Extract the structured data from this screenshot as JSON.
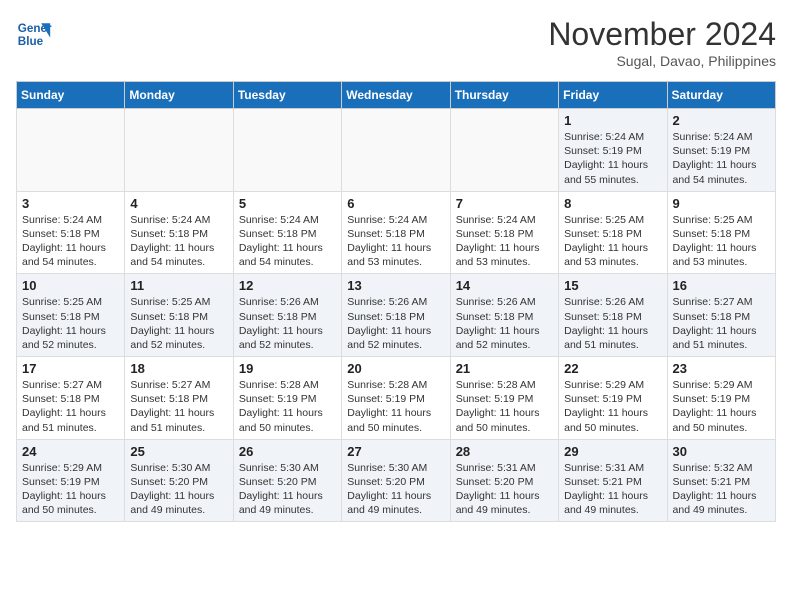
{
  "header": {
    "logo_line1": "General",
    "logo_line2": "Blue",
    "month_title": "November 2024",
    "location": "Sugal, Davao, Philippines"
  },
  "weekdays": [
    "Sunday",
    "Monday",
    "Tuesday",
    "Wednesday",
    "Thursday",
    "Friday",
    "Saturday"
  ],
  "weeks": [
    [
      {
        "day": "",
        "info": ""
      },
      {
        "day": "",
        "info": ""
      },
      {
        "day": "",
        "info": ""
      },
      {
        "day": "",
        "info": ""
      },
      {
        "day": "",
        "info": ""
      },
      {
        "day": "1",
        "info": "Sunrise: 5:24 AM\nSunset: 5:19 PM\nDaylight: 11 hours\nand 55 minutes."
      },
      {
        "day": "2",
        "info": "Sunrise: 5:24 AM\nSunset: 5:19 PM\nDaylight: 11 hours\nand 54 minutes."
      }
    ],
    [
      {
        "day": "3",
        "info": "Sunrise: 5:24 AM\nSunset: 5:18 PM\nDaylight: 11 hours\nand 54 minutes."
      },
      {
        "day": "4",
        "info": "Sunrise: 5:24 AM\nSunset: 5:18 PM\nDaylight: 11 hours\nand 54 minutes."
      },
      {
        "day": "5",
        "info": "Sunrise: 5:24 AM\nSunset: 5:18 PM\nDaylight: 11 hours\nand 54 minutes."
      },
      {
        "day": "6",
        "info": "Sunrise: 5:24 AM\nSunset: 5:18 PM\nDaylight: 11 hours\nand 53 minutes."
      },
      {
        "day": "7",
        "info": "Sunrise: 5:24 AM\nSunset: 5:18 PM\nDaylight: 11 hours\nand 53 minutes."
      },
      {
        "day": "8",
        "info": "Sunrise: 5:25 AM\nSunset: 5:18 PM\nDaylight: 11 hours\nand 53 minutes."
      },
      {
        "day": "9",
        "info": "Sunrise: 5:25 AM\nSunset: 5:18 PM\nDaylight: 11 hours\nand 53 minutes."
      }
    ],
    [
      {
        "day": "10",
        "info": "Sunrise: 5:25 AM\nSunset: 5:18 PM\nDaylight: 11 hours\nand 52 minutes."
      },
      {
        "day": "11",
        "info": "Sunrise: 5:25 AM\nSunset: 5:18 PM\nDaylight: 11 hours\nand 52 minutes."
      },
      {
        "day": "12",
        "info": "Sunrise: 5:26 AM\nSunset: 5:18 PM\nDaylight: 11 hours\nand 52 minutes."
      },
      {
        "day": "13",
        "info": "Sunrise: 5:26 AM\nSunset: 5:18 PM\nDaylight: 11 hours\nand 52 minutes."
      },
      {
        "day": "14",
        "info": "Sunrise: 5:26 AM\nSunset: 5:18 PM\nDaylight: 11 hours\nand 52 minutes."
      },
      {
        "day": "15",
        "info": "Sunrise: 5:26 AM\nSunset: 5:18 PM\nDaylight: 11 hours\nand 51 minutes."
      },
      {
        "day": "16",
        "info": "Sunrise: 5:27 AM\nSunset: 5:18 PM\nDaylight: 11 hours\nand 51 minutes."
      }
    ],
    [
      {
        "day": "17",
        "info": "Sunrise: 5:27 AM\nSunset: 5:18 PM\nDaylight: 11 hours\nand 51 minutes."
      },
      {
        "day": "18",
        "info": "Sunrise: 5:27 AM\nSunset: 5:18 PM\nDaylight: 11 hours\nand 51 minutes."
      },
      {
        "day": "19",
        "info": "Sunrise: 5:28 AM\nSunset: 5:19 PM\nDaylight: 11 hours\nand 50 minutes."
      },
      {
        "day": "20",
        "info": "Sunrise: 5:28 AM\nSunset: 5:19 PM\nDaylight: 11 hours\nand 50 minutes."
      },
      {
        "day": "21",
        "info": "Sunrise: 5:28 AM\nSunset: 5:19 PM\nDaylight: 11 hours\nand 50 minutes."
      },
      {
        "day": "22",
        "info": "Sunrise: 5:29 AM\nSunset: 5:19 PM\nDaylight: 11 hours\nand 50 minutes."
      },
      {
        "day": "23",
        "info": "Sunrise: 5:29 AM\nSunset: 5:19 PM\nDaylight: 11 hours\nand 50 minutes."
      }
    ],
    [
      {
        "day": "24",
        "info": "Sunrise: 5:29 AM\nSunset: 5:19 PM\nDaylight: 11 hours\nand 50 minutes."
      },
      {
        "day": "25",
        "info": "Sunrise: 5:30 AM\nSunset: 5:20 PM\nDaylight: 11 hours\nand 49 minutes."
      },
      {
        "day": "26",
        "info": "Sunrise: 5:30 AM\nSunset: 5:20 PM\nDaylight: 11 hours\nand 49 minutes."
      },
      {
        "day": "27",
        "info": "Sunrise: 5:30 AM\nSunset: 5:20 PM\nDaylight: 11 hours\nand 49 minutes."
      },
      {
        "day": "28",
        "info": "Sunrise: 5:31 AM\nSunset: 5:20 PM\nDaylight: 11 hours\nand 49 minutes."
      },
      {
        "day": "29",
        "info": "Sunrise: 5:31 AM\nSunset: 5:21 PM\nDaylight: 11 hours\nand 49 minutes."
      },
      {
        "day": "30",
        "info": "Sunrise: 5:32 AM\nSunset: 5:21 PM\nDaylight: 11 hours\nand 49 minutes."
      }
    ]
  ]
}
